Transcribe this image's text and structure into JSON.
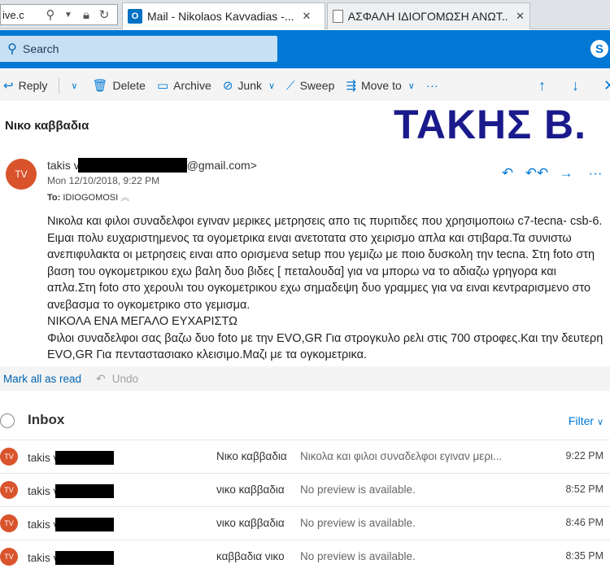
{
  "browser": {
    "address_text": "ive.c",
    "tabs": [
      {
        "label": "Mail - Nikolaos Kavvadias -...",
        "icon": "outlook-icon",
        "active": true
      },
      {
        "label": "ΑΣΦΑΛΗ ΙΔΙΟΓΟΜΩΣΗ ΑΝΩΤ...",
        "icon": "page-icon",
        "active": false
      }
    ]
  },
  "outlook": {
    "search_placeholder": "Search",
    "accent_color": "#0078d4"
  },
  "toolbar": {
    "reply_label": "Reply",
    "delete_label": "Delete",
    "archive_label": "Archive",
    "junk_label": "Junk",
    "sweep_label": "Sweep",
    "move_to_label": "Move to",
    "more_label": "···"
  },
  "message": {
    "subject": "Νικο καββαδια",
    "banner_text": "ΤΑΚΗΣ Β.",
    "avatar_initials": "TV",
    "from_prefix": "takis v",
    "from_suffix": "@gmail.com>",
    "date": "Mon 12/10/2018, 9:22 PM",
    "to_label": "To:",
    "to_value": "IDIOGOMOSI",
    "body_lines": [
      "Νικολα και φιλοι συναδελφοι εγιναν μερικες μετρησεις απο τις πυριτιδες που χρησιμοποιω c7-tecna- csb-6. Ειμαι πολυ ευχαριστημενος τα ογομετρικα ειναι ανετοτατα στο χειρισμο απλα και στιβαρα.Τα συνιστω ανεπιφυλακτα οι μετρησεις ειναι απο ορισμενα  setup που γεμιζω με  ποιο δυσκολη την tecna. Στη foto στη βαση του ογκομετρικου εχω βαλη δυο βιδες [ πεταλουδα] για να μπορω να το αδιαζω γρηγορα και απλα.Στη foto στο χερουλι του ογκομετρικου εχω σημαδεψη δυο γραμμες για να ειναι κεντραρισμενο στο ανεβασμα το ογκομετρικο στο γεμισμα.",
      "ΝΙΚΟΛΑ ΕΝΑ ΜΕΓΑΛΟ ΕΥΧΑΡΙΣΤΩ",
      "Φιλοι συναδελφοι σας βαζω δυο foto με την EVO,GR Για στρογκυλο ρελι στις 700 στροφες.Και την δευτερη EVO,GR Για πενταστασιακο κλεισιμο.Μαζι με τα ογκομετρικα."
    ]
  },
  "markbar": {
    "mark_all_label": "Mark all as read",
    "undo_label": "Undo"
  },
  "inbox": {
    "title": "Inbox",
    "filter_label": "Filter",
    "rows": [
      {
        "initials": "TV",
        "sender": "takis v",
        "subject": "Νικο καββαδια",
        "preview": "Νικολα και φιλοι συναδελφοι εγιναν μερι...",
        "time": "9:22 PM"
      },
      {
        "initials": "TV",
        "sender": "takis v",
        "subject": "νικο καββαδια",
        "preview": "No preview is available.",
        "time": "8:52 PM"
      },
      {
        "initials": "TV",
        "sender": "takis v",
        "subject": "νικο καββαδια",
        "preview": "No preview is available.",
        "time": "8:46 PM"
      },
      {
        "initials": "TV",
        "sender": "takis v",
        "subject": "καββαδια νικο",
        "preview": "No preview is available.",
        "time": "8:35 PM"
      }
    ]
  }
}
